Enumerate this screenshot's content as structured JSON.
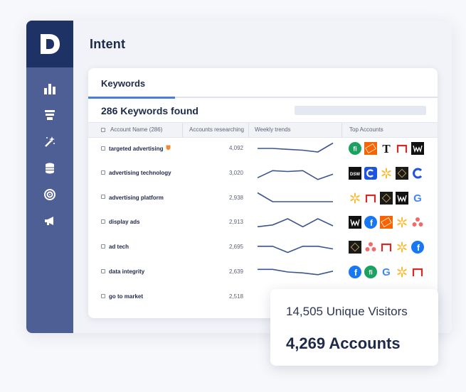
{
  "page": {
    "title": "Intent"
  },
  "sidebar": {
    "logo_letter": "D",
    "items": [
      {
        "icon": "bar-chart-icon"
      },
      {
        "icon": "funnel-icon"
      },
      {
        "icon": "magic-wand-icon"
      },
      {
        "icon": "database-icon"
      },
      {
        "icon": "target-icon"
      },
      {
        "icon": "megaphone-icon"
      }
    ]
  },
  "keywords": {
    "tab_label": "Keywords",
    "found_label": "286 Keywords found",
    "columns": {
      "account_name": "Account Name (286)",
      "accounts_researching": "Accounts researching",
      "weekly_trends": "Weekly trends",
      "top_accounts": "Top Accounts"
    },
    "rows": [
      {
        "name": "targeted advertising",
        "count": "4,092",
        "trend": [
          8,
          8,
          7,
          6,
          4,
          14
        ],
        "badge": true,
        "logos": [
          "fi",
          "homedepot",
          "nyt",
          "arch",
          "wwe"
        ]
      },
      {
        "name": "advertising technology",
        "count": "3,020",
        "trend": [
          3,
          11,
          10,
          11,
          1,
          7
        ],
        "badge": false,
        "logos": [
          "dsw",
          "coupa",
          "walmart",
          "ray",
          "coupa-b"
        ]
      },
      {
        "name": "advertising platform",
        "count": "2,938",
        "trend": [
          14,
          4,
          4,
          4,
          4,
          4
        ],
        "badge": false,
        "logos": [
          "walmart",
          "arch",
          "ray",
          "wwe",
          "google"
        ]
      },
      {
        "name": "display ads",
        "count": "2,913",
        "trend": [
          3,
          5,
          12,
          3,
          12,
          4
        ],
        "badge": false,
        "logos": [
          "wwe",
          "facebook",
          "homedepot",
          "walmart",
          "asana"
        ]
      },
      {
        "name": "ad tech",
        "count": "2,695",
        "trend": [
          9,
          9,
          2,
          9,
          9,
          6
        ],
        "badge": false,
        "logos": [
          "ray",
          "asana",
          "arch",
          "walmart",
          "facebook"
        ]
      },
      {
        "name": "data integrity",
        "count": "2,639",
        "trend": [
          11,
          11,
          8,
          7,
          5,
          9
        ],
        "badge": false,
        "logos": [
          "facebook",
          "fi",
          "google",
          "walmart",
          "arch"
        ]
      },
      {
        "name": "go to market",
        "count": "2,518",
        "trend": [],
        "badge": false,
        "logos": []
      }
    ]
  },
  "summary": {
    "visitors": "14,505 Unique Visitors",
    "accounts": "4,269 Accounts"
  },
  "colors": {
    "sidebar": "#4e5f95",
    "brand": "#1e3265",
    "accent": "#4a7fd0",
    "trend_line": "#3d558f"
  }
}
